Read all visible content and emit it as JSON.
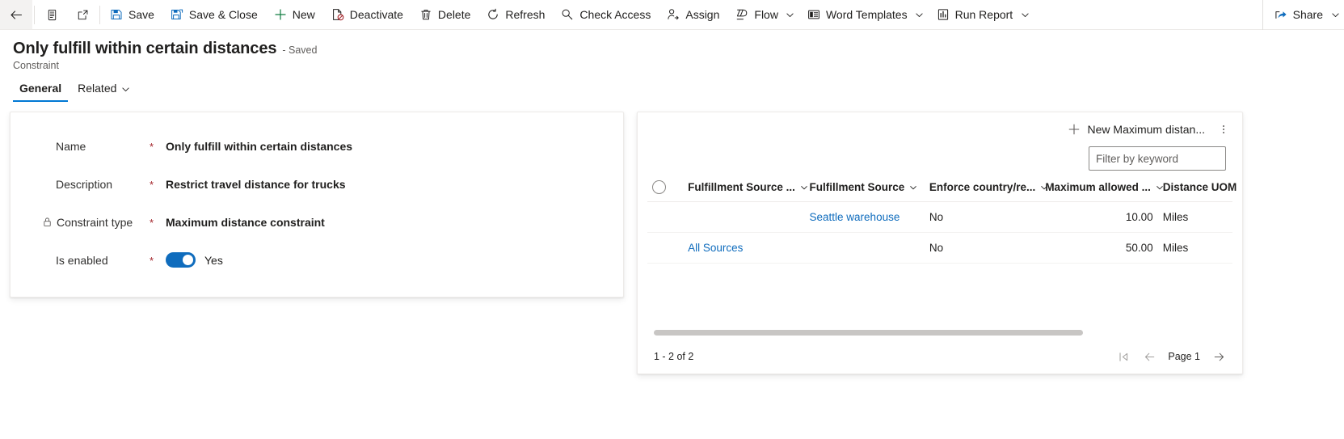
{
  "commandbar": {
    "back_label": "Back",
    "form_selector_label": "Form selector",
    "popout_label": "Open in new window",
    "items": [
      {
        "id": "save",
        "label": "Save",
        "icon": "save-icon",
        "caret": false
      },
      {
        "id": "save-close",
        "label": "Save & Close",
        "icon": "save-close-icon",
        "caret": false
      },
      {
        "id": "new",
        "label": "New",
        "icon": "plus-icon",
        "caret": false
      },
      {
        "id": "deactivate",
        "label": "Deactivate",
        "icon": "deactivate-icon",
        "caret": false
      },
      {
        "id": "delete",
        "label": "Delete",
        "icon": "trash-icon",
        "caret": false
      },
      {
        "id": "refresh",
        "label": "Refresh",
        "icon": "refresh-icon",
        "caret": false
      },
      {
        "id": "check-access",
        "label": "Check Access",
        "icon": "key-icon",
        "caret": false
      },
      {
        "id": "assign",
        "label": "Assign",
        "icon": "assign-user-icon",
        "caret": false
      },
      {
        "id": "flow",
        "label": "Flow",
        "icon": "flow-icon",
        "caret": true
      },
      {
        "id": "word-templates",
        "label": "Word Templates",
        "icon": "word-template-icon",
        "caret": true
      },
      {
        "id": "run-report",
        "label": "Run Report",
        "icon": "report-icon",
        "caret": true
      }
    ],
    "share": {
      "label": "Share",
      "icon": "share-icon",
      "caret": true
    }
  },
  "header": {
    "title": "Only fulfill within certain distances",
    "save_state": "- Saved",
    "entity": "Constraint"
  },
  "tabs": [
    {
      "id": "general",
      "label": "General",
      "active": true,
      "caret": false
    },
    {
      "id": "related",
      "label": "Related",
      "active": false,
      "caret": true
    }
  ],
  "form": {
    "fields": [
      {
        "label": "Name",
        "required": "*",
        "value": "Only fulfill within certain distances",
        "locked": false,
        "type": "text"
      },
      {
        "label": "Description",
        "required": "*",
        "value": "Restrict travel distance for trucks",
        "locked": false,
        "type": "text"
      },
      {
        "label": "Constraint type",
        "required": "*",
        "value": "Maximum distance constraint",
        "locked": true,
        "type": "text"
      },
      {
        "label": "Is enabled",
        "required": "*",
        "value": "Yes",
        "locked": false,
        "type": "toggle",
        "toggle_on": true
      }
    ]
  },
  "subgrid": {
    "new_record_label": "New Maximum distan...",
    "more_commands_label": "More commands",
    "filter_placeholder": "Filter by keyword",
    "filter_value": "",
    "select_all_label": "Select all rows",
    "columns": [
      {
        "id": "fulfillment-source-type",
        "label": "Fulfillment Source ...",
        "sortable": true,
        "align": "left"
      },
      {
        "id": "fulfillment-source",
        "label": "Fulfillment Source",
        "sortable": true,
        "align": "left"
      },
      {
        "id": "enforce-country",
        "label": "Enforce country/re...",
        "sortable": true,
        "align": "left"
      },
      {
        "id": "maximum-allowed",
        "label": "Maximum allowed ...",
        "sortable": true,
        "align": "right"
      },
      {
        "id": "distance-uom",
        "label": "Distance UOM",
        "sortable": false,
        "align": "left"
      }
    ],
    "rows": [
      {
        "fulfillment_source_type": "",
        "fulfillment_source": "Seattle warehouse",
        "fulfillment_source_is_link": true,
        "enforce_country": "No",
        "maximum_allowed": "10.00",
        "distance_uom": "Miles"
      },
      {
        "fulfillment_source_type": "All Sources",
        "fulfillment_source_type_is_link": true,
        "fulfillment_source": "",
        "enforce_country": "No",
        "maximum_allowed": "50.00",
        "distance_uom": "Miles"
      }
    ],
    "footer": {
      "record_count": "1 - 2 of 2",
      "page_label": "Page 1",
      "first_page_label": "First page",
      "previous_page_label": "Previous page",
      "next_page_label": "Next page"
    }
  },
  "colors": {
    "accent": "#0078d4",
    "link": "#0f6cbd",
    "required": "#a4262c",
    "toggle_on": "#0f6cbd",
    "new_green": "#107c41",
    "delete_grey": "#605e5c"
  }
}
